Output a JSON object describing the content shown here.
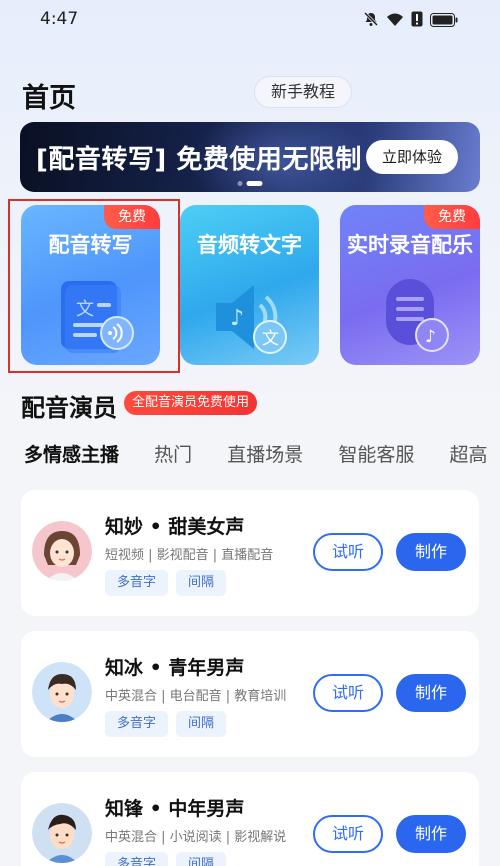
{
  "status": {
    "time": "4:47",
    "icons": [
      "bell-off-icon",
      "wifi-icon",
      "alert-icon",
      "battery-icon"
    ]
  },
  "header": {
    "title": "首页",
    "tutorial": "新手教程"
  },
  "banner": {
    "text": "[配音转写] 免费使用无限制",
    "cta": "立即体验"
  },
  "features": [
    {
      "title": "配音转写",
      "badge": "免费",
      "icon": "document-text-icon",
      "icon_glyph": "文"
    },
    {
      "title": "音频转文字",
      "badge": "",
      "icon": "speaker-text-icon",
      "icon_glyph": "文"
    },
    {
      "title": "实时录音配乐",
      "badge": "免费",
      "icon": "microphone-music-icon",
      "icon_glyph": "♪"
    }
  ],
  "section": {
    "title": "配音演员",
    "badge": "全配音演员免费使用"
  },
  "tabs": [
    "多情感主播",
    "热门",
    "直播场景",
    "智能客服",
    "超高"
  ],
  "voices": [
    {
      "name": "知妙 • 甜美女声",
      "tags": "短视频 | 影视配音 | 直播配音",
      "chips": [
        "多音字",
        "间隔"
      ],
      "listen": "试听",
      "make": "制作"
    },
    {
      "name": "知冰 • 青年男声",
      "tags": "中英混合 | 电台配音 | 教育培训",
      "chips": [
        "多音字",
        "间隔"
      ],
      "listen": "试听",
      "make": "制作"
    },
    {
      "name": "知锋 • 中年男声",
      "tags": "中英混合 | 小说阅读 | 影视解说",
      "chips": [
        "多音字",
        "间隔"
      ],
      "listen": "试听",
      "make": "制作"
    }
  ],
  "colors": {
    "accent": "#2a67ee",
    "badge": "#f43333",
    "selection": "#d9302a"
  }
}
